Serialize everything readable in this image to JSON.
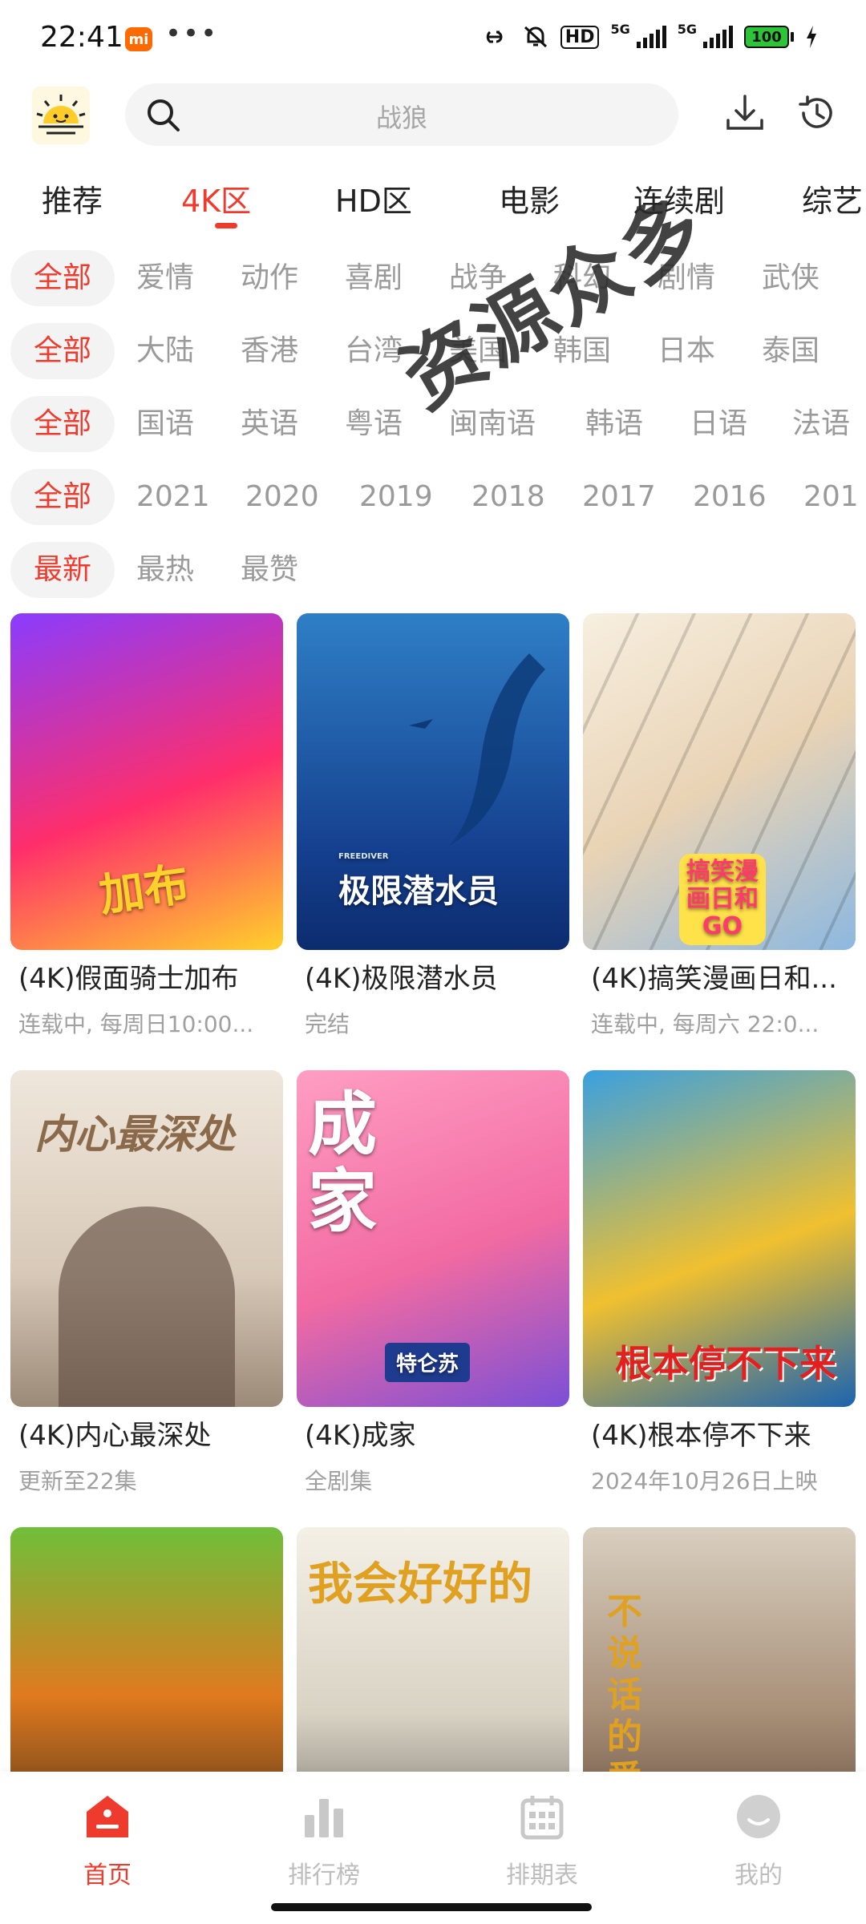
{
  "status": {
    "time": "22:41",
    "mi_badge": "mi",
    "dots": "•••",
    "hd": "HD",
    "net1": "5G",
    "net2": "5G",
    "battery": "100"
  },
  "header": {
    "search_placeholder": "战狼"
  },
  "tabs": [
    {
      "label": "推荐"
    },
    {
      "label": "4K区"
    },
    {
      "label": "HD区"
    },
    {
      "label": "电影"
    },
    {
      "label": "连续剧"
    },
    {
      "label": "综艺"
    }
  ],
  "filters": {
    "genre": [
      "全部",
      "爱情",
      "动作",
      "喜剧",
      "战争",
      "科幻",
      "剧情",
      "武侠"
    ],
    "region": [
      "全部",
      "大陆",
      "香港",
      "台湾",
      "美国",
      "韩国",
      "日本",
      "泰国"
    ],
    "language": [
      "全部",
      "国语",
      "英语",
      "粤语",
      "闽南语",
      "韩语",
      "日语",
      "法语"
    ],
    "year": [
      "全部",
      "2021",
      "2020",
      "2019",
      "2018",
      "2017",
      "2016",
      "201"
    ],
    "sort": [
      "最新",
      "最热",
      "最赞"
    ]
  },
  "watermark": "资源众多",
  "cards": [
    {
      "title": "(4K)假面骑士加布",
      "subtitle": "连载中, 每周日10:00...",
      "poster_text": "加布",
      "colors": [
        "#8a3cff",
        "#ff2e6b",
        "#ffd12b"
      ]
    },
    {
      "title": "(4K)极限潜水员",
      "subtitle": "完结",
      "poster_text": "极限潜水员",
      "poster_small": "FREEDIVER",
      "colors": [
        "#2f7fc6",
        "#15408f",
        "#0c2c6e"
      ]
    },
    {
      "title": "(4K)搞笑漫画日和...",
      "subtitle": "连载中, 每周六 22:0...",
      "poster_text": "搞笑漫画日和GO",
      "colors": [
        "#f7efe0",
        "#e9d3b5",
        "#8cb8e0"
      ]
    },
    {
      "title": "(4K)内心最深处",
      "subtitle": "更新至22集",
      "poster_text": "内心最深处",
      "colors": [
        "#efe7dc",
        "#d8c9b8",
        "#9c8a78"
      ]
    },
    {
      "title": "(4K)成家",
      "subtitle": "全剧集",
      "poster_text": "成家",
      "poster_small": "特仑苏",
      "colors": [
        "#ff9ec3",
        "#f26aa2",
        "#7b4fd6"
      ]
    },
    {
      "title": "(4K)根本停不下来",
      "subtitle": "2024年10月26日上映",
      "poster_text": "根本停不下来",
      "colors": [
        "#3aa0e0",
        "#f0c030",
        "#1b64b0"
      ]
    },
    {
      "title": "",
      "subtitle": "",
      "poster_text": "",
      "colors": [
        "#6fbf3a",
        "#e07a1f",
        "#3a2a1a"
      ]
    },
    {
      "title": "",
      "subtitle": "",
      "poster_text": "我会好好的",
      "colors": [
        "#f4f0e6",
        "#d9d3c4",
        "#6d6a62"
      ]
    },
    {
      "title": "",
      "subtitle": "",
      "poster_text": "不说话的爱",
      "colors": [
        "#d9cfc0",
        "#a88f78",
        "#5a4636"
      ]
    }
  ],
  "nav": [
    {
      "label": "首页",
      "icon": "home-icon",
      "active": true
    },
    {
      "label": "排行榜",
      "icon": "ranking-icon",
      "active": false
    },
    {
      "label": "排期表",
      "icon": "calendar-icon",
      "active": false
    },
    {
      "label": "我的",
      "icon": "profile-icon",
      "active": false
    }
  ],
  "theme": {
    "accent": "#ef3b2d"
  }
}
